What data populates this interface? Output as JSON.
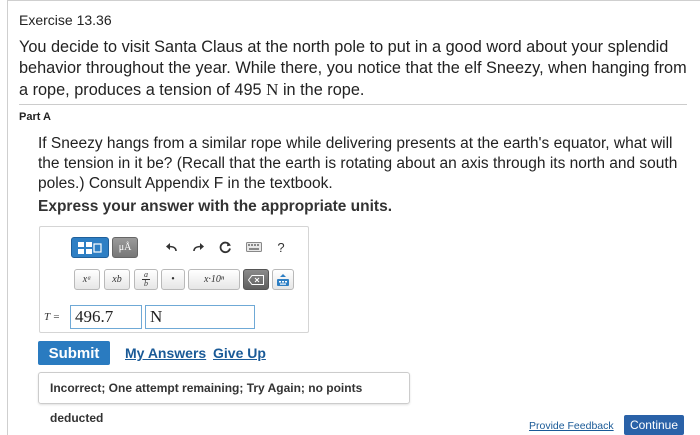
{
  "exercise": {
    "title": "Exercise 13.36"
  },
  "problem": {
    "text_before": "You decide to visit Santa Claus at the north pole to put in a good word about your splendid behavior throughout the year. While there, you notice that the elf Sneezy, when hanging from a rope, produces a tension of 495",
    "unit": "N",
    "text_after": "in the rope."
  },
  "part": {
    "label": "Part A",
    "question": "If Sneezy hangs from a similar rope while delivering presents at the earth's equator, what will the tension in it be? (Recall that the earth is rotating about an axis through its north and south poles.) Consult Appendix F in the textbook.",
    "instruction": "Express your answer with the appropriate units."
  },
  "toolbar": {
    "templates_icon": "templates-icon",
    "units_label": "μÅ",
    "undo_icon": "undo-icon",
    "redo_icon": "redo-icon",
    "reset_icon": "reset-icon",
    "keyboard_icon": "keyboard-icon",
    "help_label": "?",
    "superscript_label": "xᵃ",
    "subscript_label": "xb",
    "fraction_top": "a",
    "fraction_bottom": "b",
    "dot_label": "•",
    "sci_notation_label": "x·10ⁿ",
    "backspace_icon": "backspace-icon",
    "keypad_icon": "keypad-icon"
  },
  "answer": {
    "variable_label": "T =",
    "value": "496.7",
    "unit": "N"
  },
  "actions": {
    "submit_label": "Submit",
    "my_answers_label": "My Answers",
    "give_up_label": "Give Up"
  },
  "feedback": {
    "message": "Incorrect; One attempt remaining; Try Again; no points deducted"
  },
  "footer": {
    "provide_feedback_label": "Provide Feedback",
    "continue_label": "Continue"
  },
  "colors": {
    "primary_button": "#2a7bc0",
    "link": "#1a5a97",
    "input_border": "#6fa9d6"
  }
}
